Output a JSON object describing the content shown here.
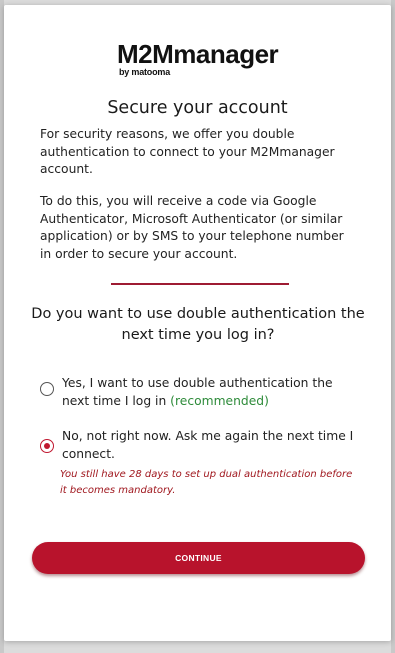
{
  "logo": {
    "main": "M2Mmanager",
    "sub": "by matooma"
  },
  "title": "Secure your account",
  "intro": {
    "paragraph1": "For security reasons, we offer you double authentication to connect to your M2Mmanager account.",
    "paragraph2": "To do this, you will receive a code via Google Authenticator, Microsoft Authenticator (or similar application) or by SMS to your telephone number in order to secure your account."
  },
  "question": "Do you want to use double authentication the next time you log in?",
  "options": [
    {
      "label": "Yes, I want to use double authentication the next time I log in",
      "suffix": "(recommended)",
      "selected": false
    },
    {
      "label": "No, not right now. Ask me again the next time I connect.",
      "selected": true
    }
  ],
  "warning": "You still have 28 days to set up dual authentication before it becomes mandatory.",
  "continue_label": "CONTINUE",
  "colors": {
    "accent": "#b8132c",
    "divider": "#9e1b32",
    "recommended": "#2e8b3a",
    "warning": "#a0181f"
  }
}
